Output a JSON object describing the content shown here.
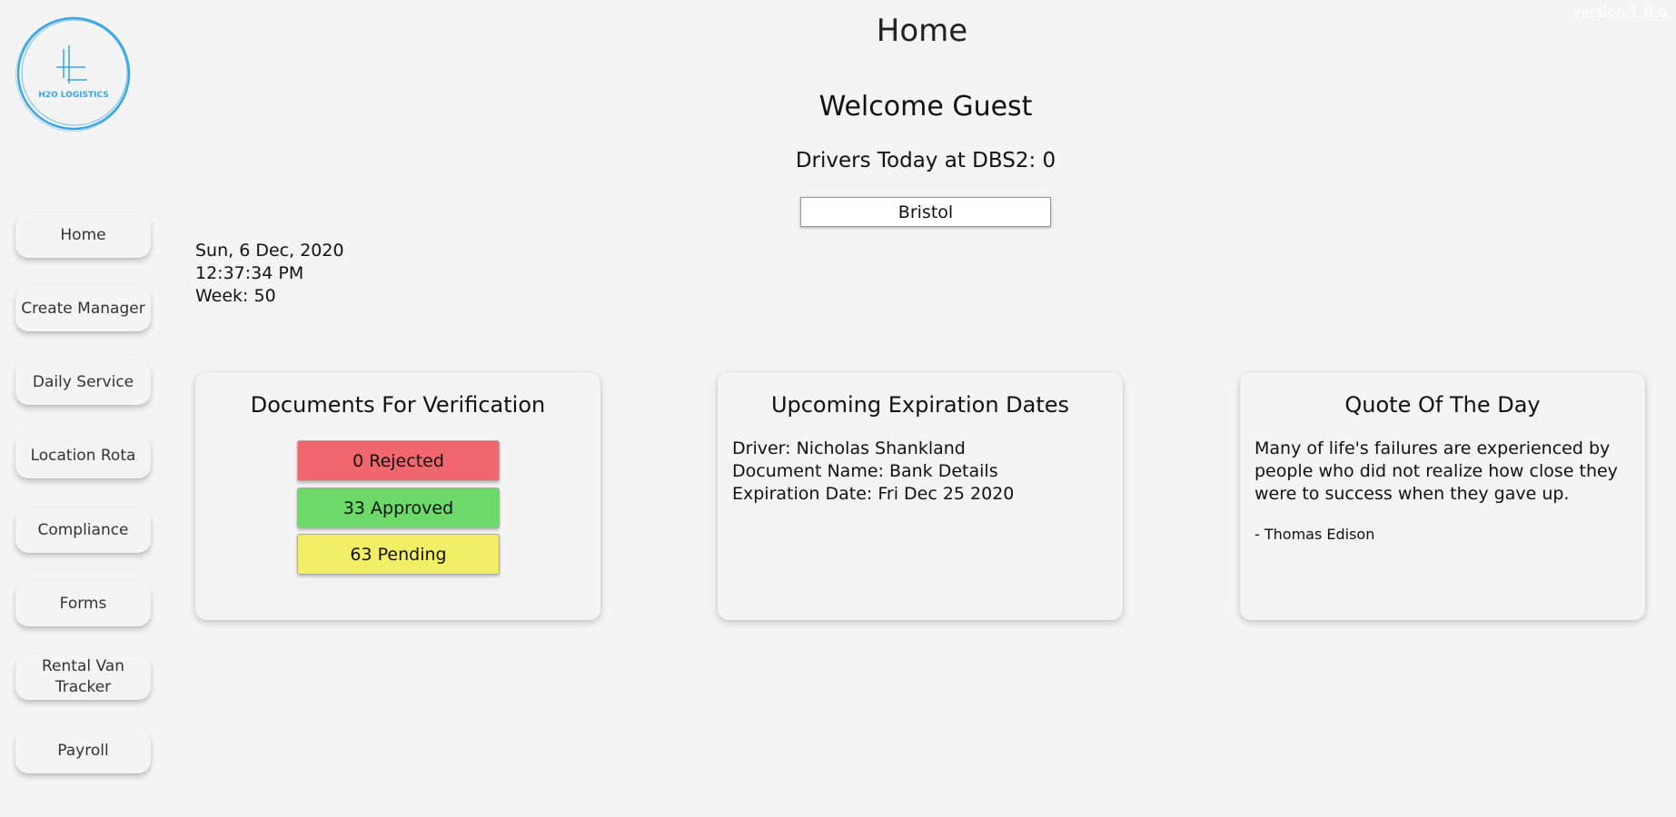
{
  "app": {
    "version": "version 1.0.0",
    "logo_text": "H2O  LOGISTICS",
    "logo_mark": "HL"
  },
  "sidebar": {
    "items": [
      {
        "label": "Home"
      },
      {
        "label": "Create Manager"
      },
      {
        "label": "Daily Service"
      },
      {
        "label": "Location Rota"
      },
      {
        "label": "Compliance"
      },
      {
        "label": "Forms"
      },
      {
        "label": "Rental Van Tracker"
      },
      {
        "label": "Payroll"
      }
    ]
  },
  "header": {
    "title": "Home",
    "welcome": "Welcome Guest",
    "drivers_today": "Drivers Today at DBS2: 0",
    "location": "Bristol"
  },
  "datetime": {
    "date": "Sun, 6 Dec, 2020",
    "time": "12:37:34 PM",
    "week": "Week: 50"
  },
  "documents": {
    "title": "Documents For Verification",
    "rejected": "0 Rejected",
    "approved": "33 Approved",
    "pending": "63 Pending"
  },
  "expiration": {
    "title": "Upcoming Expiration Dates",
    "driver": "Driver: Nicholas Shankland",
    "document_name": "Document Name: Bank Details",
    "expiration_date": "Expiration Date: Fri Dec 25 2020"
  },
  "quote": {
    "title": "Quote Of The Day",
    "text": "Many of life's failures are experienced by people who did not realize how close they were to success when they gave up.",
    "author": "- Thomas Edison"
  },
  "colors": {
    "rejected": "#f2666d",
    "approved": "#6cd96a",
    "pending": "#f2ef66",
    "logo": "#3aa5e0"
  }
}
